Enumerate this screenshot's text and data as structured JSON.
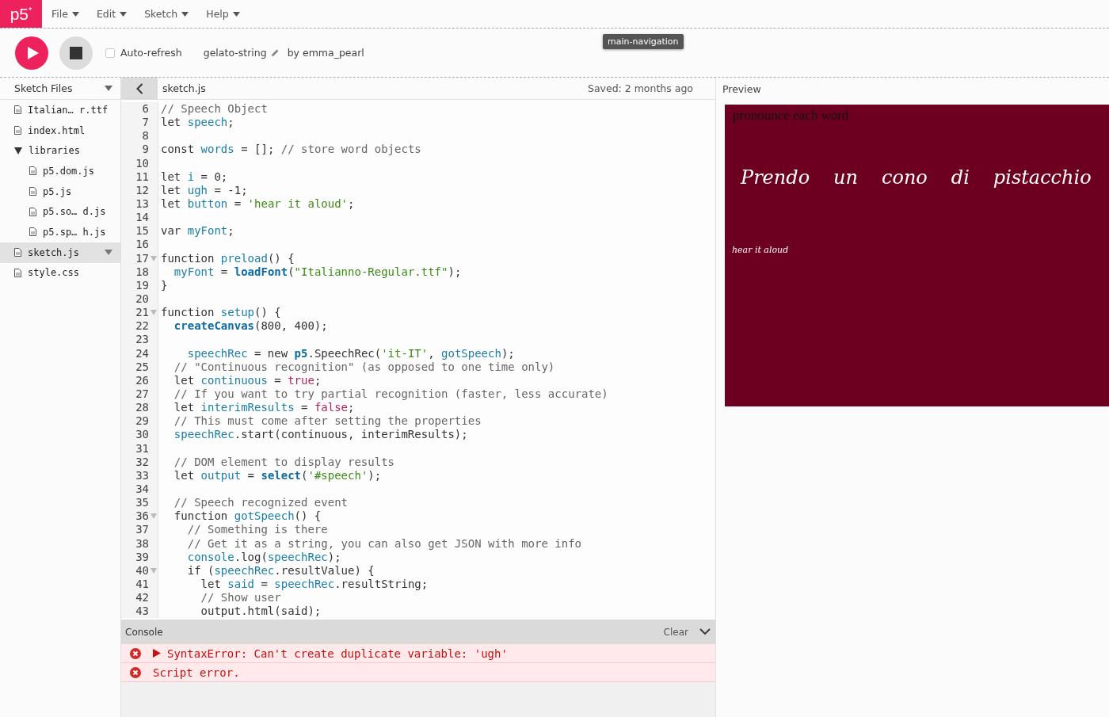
{
  "logo": {
    "text": "p5",
    "mark": "*"
  },
  "menu": [
    {
      "label": "File"
    },
    {
      "label": "Edit"
    },
    {
      "label": "Sketch"
    },
    {
      "label": "Help"
    }
  ],
  "tooltip": "main-navigation",
  "toolbar": {
    "auto_refresh": {
      "label": "Auto-refresh",
      "checked": false
    },
    "sketch_name": "gelato-string",
    "author": "by emma_pearl"
  },
  "sidebar": {
    "title": "Sketch Files",
    "items": [
      {
        "name": "Italian… r.ttf",
        "kind": "file",
        "selected": false
      },
      {
        "name": "index.html",
        "kind": "file",
        "selected": false
      },
      {
        "name": "libraries",
        "kind": "folder",
        "expanded": true,
        "selected": false,
        "children": [
          {
            "name": "p5.dom.js",
            "kind": "file",
            "selected": false
          },
          {
            "name": "p5.js",
            "kind": "file",
            "selected": false
          },
          {
            "name": "p5.so… d.js",
            "kind": "file",
            "selected": false
          },
          {
            "name": "p5.sp… h.js",
            "kind": "file",
            "selected": false
          }
        ]
      },
      {
        "name": "sketch.js",
        "kind": "file",
        "selected": true
      },
      {
        "name": "style.css",
        "kind": "file",
        "selected": false
      }
    ]
  },
  "editor": {
    "file_name": "sketch.js",
    "saved": "Saved: 2 months ago",
    "lines": [
      {
        "number": "6",
        "tokens": [
          {
            "kind": "comment",
            "text": "// Speech Object"
          }
        ]
      },
      {
        "number": "7",
        "tokens": [
          {
            "kind": "plain",
            "text": "let "
          },
          {
            "kind": "def",
            "text": "speech"
          },
          {
            "kind": "plain",
            "text": ";"
          }
        ]
      },
      {
        "number": "8"
      },
      {
        "number": "9",
        "tokens": [
          {
            "kind": "plain",
            "text": "const "
          },
          {
            "kind": "def",
            "text": "words"
          },
          {
            "kind": "plain",
            "text": " = []; "
          },
          {
            "kind": "comment",
            "text": "// store word objects"
          }
        ]
      },
      {
        "number": "10"
      },
      {
        "number": "11",
        "tokens": [
          {
            "kind": "plain",
            "text": "let "
          },
          {
            "kind": "def",
            "text": "i"
          },
          {
            "kind": "plain",
            "text": " = 0;"
          }
        ]
      },
      {
        "number": "12",
        "tokens": [
          {
            "kind": "plain",
            "text": "let "
          },
          {
            "kind": "def",
            "text": "ugh"
          },
          {
            "kind": "plain",
            "text": " = -1;"
          }
        ]
      },
      {
        "number": "13",
        "tokens": [
          {
            "kind": "plain",
            "text": "let "
          },
          {
            "kind": "def",
            "text": "button"
          },
          {
            "kind": "plain",
            "text": " = "
          },
          {
            "kind": "string",
            "text": "'hear it aloud'"
          },
          {
            "kind": "plain",
            "text": ";"
          }
        ]
      },
      {
        "number": "14"
      },
      {
        "number": "15",
        "tokens": [
          {
            "kind": "plain",
            "text": "var "
          },
          {
            "kind": "def",
            "text": "myFont"
          },
          {
            "kind": "plain",
            "text": ";"
          }
        ]
      },
      {
        "number": "16"
      },
      {
        "number": "17",
        "foldable": true,
        "tokens": [
          {
            "kind": "plain",
            "text": "function "
          },
          {
            "kind": "def",
            "text": "preload"
          },
          {
            "kind": "plain",
            "text": "() {"
          }
        ]
      },
      {
        "number": "18",
        "tokens": [
          {
            "kind": "def",
            "text": "  myFont"
          },
          {
            "kind": "plain",
            "text": " = "
          },
          {
            "kind": "builtin",
            "text": "loadFont"
          },
          {
            "kind": "plain",
            "text": "("
          },
          {
            "kind": "string",
            "text": "\"Italianno-Regular.ttf\""
          },
          {
            "kind": "plain",
            "text": ");"
          }
        ]
      },
      {
        "number": "19",
        "tokens": [
          {
            "kind": "plain",
            "text": "}"
          }
        ]
      },
      {
        "number": "20"
      },
      {
        "number": "21",
        "foldable": true,
        "tokens": [
          {
            "kind": "plain",
            "text": "function "
          },
          {
            "kind": "def",
            "text": "setup"
          },
          {
            "kind": "plain",
            "text": "() {"
          }
        ]
      },
      {
        "number": "22",
        "tokens": [
          {
            "kind": "builtin",
            "text": "  createCanvas"
          },
          {
            "kind": "plain",
            "text": "(800, 400);"
          }
        ]
      },
      {
        "number": "23"
      },
      {
        "number": "24",
        "tokens": [
          {
            "kind": "def",
            "text": "    speechRec"
          },
          {
            "kind": "plain",
            "text": " = new "
          },
          {
            "kind": "builtin",
            "text": "p5"
          },
          {
            "kind": "plain",
            "text": ".SpeechRec("
          },
          {
            "kind": "string",
            "text": "'it-IT'"
          },
          {
            "kind": "plain",
            "text": ", "
          },
          {
            "kind": "def",
            "text": "gotSpeech"
          },
          {
            "kind": "plain",
            "text": ");"
          }
        ]
      },
      {
        "number": "25",
        "tokens": [
          {
            "kind": "comment",
            "text": "  // \"Continuous recognition\" (as opposed to one time only)"
          }
        ]
      },
      {
        "number": "26",
        "tokens": [
          {
            "kind": "plain",
            "text": "  let "
          },
          {
            "kind": "def",
            "text": "continuous"
          },
          {
            "kind": "plain",
            "text": " = "
          },
          {
            "kind": "atom",
            "text": "true"
          },
          {
            "kind": "plain",
            "text": ";"
          }
        ]
      },
      {
        "number": "27",
        "tokens": [
          {
            "kind": "comment",
            "text": "  // If you want to try partial recognition (faster, less accurate)"
          }
        ]
      },
      {
        "number": "28",
        "tokens": [
          {
            "kind": "plain",
            "text": "  let "
          },
          {
            "kind": "def",
            "text": "interimResults"
          },
          {
            "kind": "plain",
            "text": " = "
          },
          {
            "kind": "atom",
            "text": "false"
          },
          {
            "kind": "plain",
            "text": ";"
          }
        ]
      },
      {
        "number": "29",
        "tokens": [
          {
            "kind": "comment",
            "text": "  // This must come after setting the properties"
          }
        ]
      },
      {
        "number": "30",
        "tokens": [
          {
            "kind": "def",
            "text": "  speechRec"
          },
          {
            "kind": "plain",
            "text": ".start(continuous, interimResults);"
          }
        ]
      },
      {
        "number": "31"
      },
      {
        "number": "32",
        "tokens": [
          {
            "kind": "comment",
            "text": "  // DOM element to display results"
          }
        ]
      },
      {
        "number": "33",
        "tokens": [
          {
            "kind": "plain",
            "text": "  let "
          },
          {
            "kind": "def",
            "text": "output"
          },
          {
            "kind": "plain",
            "text": " = "
          },
          {
            "kind": "builtin",
            "text": "select"
          },
          {
            "kind": "plain",
            "text": "("
          },
          {
            "kind": "string",
            "text": "'#speech'"
          },
          {
            "kind": "plain",
            "text": ");"
          }
        ]
      },
      {
        "number": "34"
      },
      {
        "number": "35",
        "tokens": [
          {
            "kind": "comment",
            "text": "  // Speech recognized event"
          }
        ]
      },
      {
        "number": "36",
        "foldable": true,
        "tokens": [
          {
            "kind": "plain",
            "text": "  function "
          },
          {
            "kind": "def",
            "text": "gotSpeech"
          },
          {
            "kind": "plain",
            "text": "() {"
          }
        ]
      },
      {
        "number": "37",
        "tokens": [
          {
            "kind": "comment",
            "text": "    // Something is there"
          }
        ]
      },
      {
        "number": "38",
        "tokens": [
          {
            "kind": "comment",
            "text": "    // Get it as a string, you can also get JSON with more info"
          }
        ]
      },
      {
        "number": "39",
        "tokens": [
          {
            "kind": "def",
            "text": "    console"
          },
          {
            "kind": "plain",
            "text": ".log("
          },
          {
            "kind": "def",
            "text": "speechRec"
          },
          {
            "kind": "plain",
            "text": ");"
          }
        ]
      },
      {
        "number": "40",
        "foldable": true,
        "tokens": [
          {
            "kind": "plain",
            "text": "    if ("
          },
          {
            "kind": "def",
            "text": "speechRec"
          },
          {
            "kind": "plain",
            "text": ".resultValue) {"
          }
        ]
      },
      {
        "number": "41",
        "tokens": [
          {
            "kind": "plain",
            "text": "      let "
          },
          {
            "kind": "def",
            "text": "said"
          },
          {
            "kind": "plain",
            "text": " = "
          },
          {
            "kind": "def",
            "text": "speechRec"
          },
          {
            "kind": "plain",
            "text": ".resultString;"
          }
        ]
      },
      {
        "number": "42",
        "tokens": [
          {
            "kind": "comment",
            "text": "      // Show user"
          }
        ]
      },
      {
        "number": "43",
        "tokens": [
          {
            "kind": "plain",
            "text": "      output.html(said);"
          }
        ]
      }
    ]
  },
  "console": {
    "title": "Console",
    "clear": "Clear",
    "entries": [
      {
        "kind": "error",
        "expandable": true,
        "text": "SyntaxError: Can't create duplicate variable: 'ugh'"
      },
      {
        "kind": "error",
        "expandable": false,
        "text": "Script error."
      }
    ]
  },
  "preview": {
    "title": "Preview",
    "heading": "pronounce each word",
    "words": [
      "Prendo",
      "un",
      "cono",
      "di",
      "pistacchio"
    ],
    "button": "hear it aloud"
  }
}
